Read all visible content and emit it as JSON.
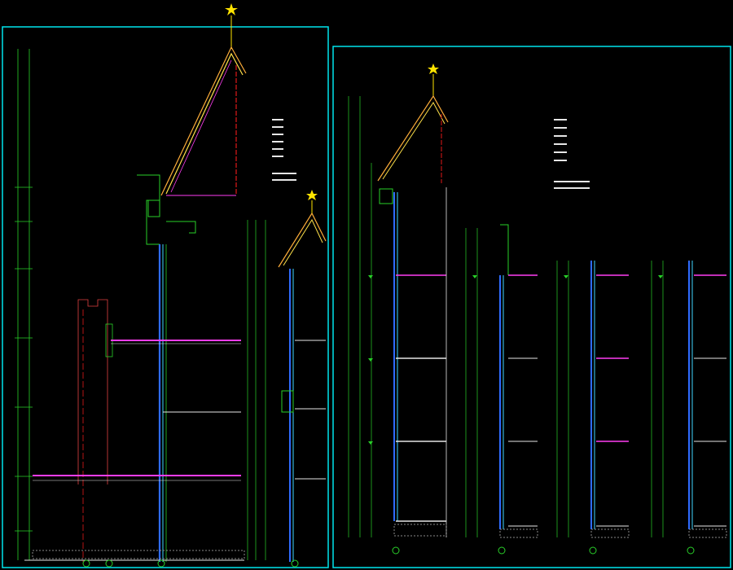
{
  "drawing": {
    "frame_color": "#00e5ee",
    "colors": {
      "dim_green": "#29d129",
      "wall_blue": "#2f6bff",
      "glass_cyan": "#3fd6ff",
      "slab_magenta": "#ff3df2",
      "axis_red": "#e01919",
      "roof_orange": "#ffae3a",
      "roof_yellow": "#ffe24a",
      "hatch_grey": "#8a8a8a",
      "text_white": "#e6e6e6",
      "star_yellow": "#ffe400"
    },
    "icons": [
      "spire-star-icon",
      "axis-bubble-icon",
      "level-marker-icon",
      "legend-swatch-icon",
      "ground-hatch-icon"
    ]
  },
  "left_sheet": {
    "room_labels": [
      "",
      "",
      "",
      "",
      "",
      "",
      "",
      ""
    ],
    "detail_title": ""
  },
  "right_sheet": {
    "room_labels": [
      "",
      "",
      "",
      "",
      "",
      "",
      "",
      "",
      "",
      "",
      "",
      "",
      ""
    ]
  }
}
